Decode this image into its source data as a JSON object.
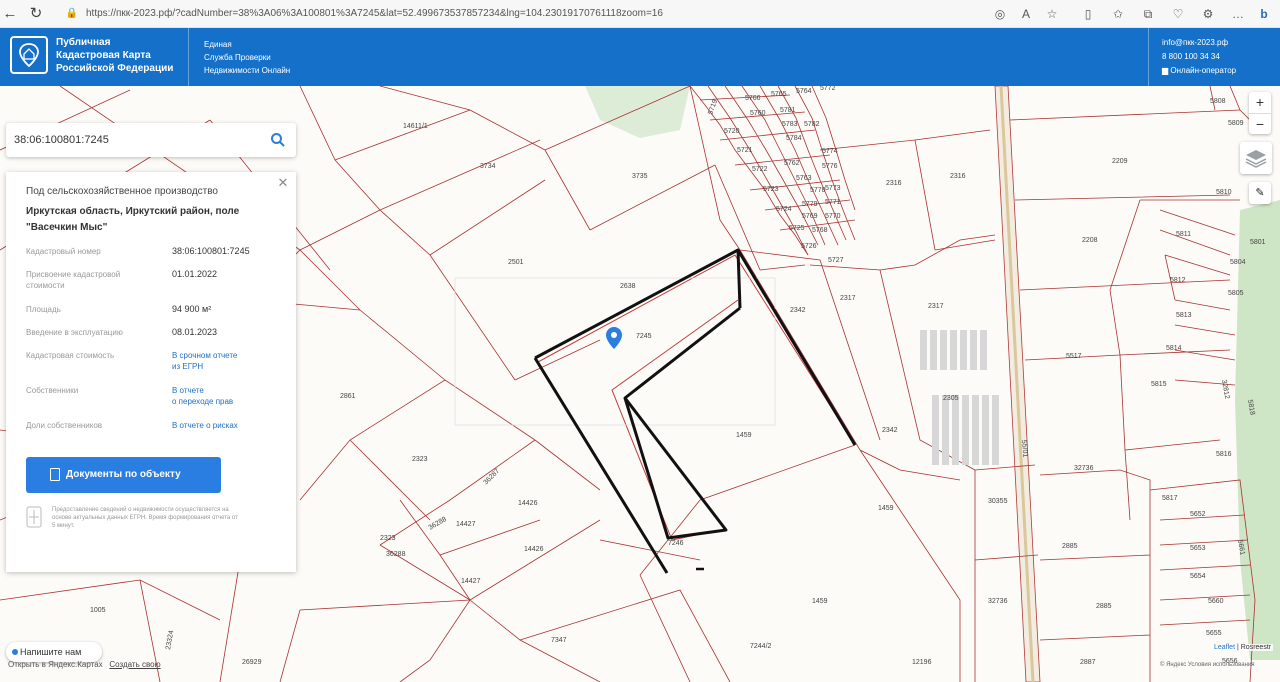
{
  "browser": {
    "url": "https://пкк-2023.рф/?cadNumber=38%3A06%3A100801%3A7245&lat=52.499673537857234&lng=104.23019170761118zoom=16"
  },
  "header": {
    "title_lines": [
      "Публичная",
      "Кадастровая Карта",
      "Российской Федерации"
    ],
    "service_lines": [
      "Единая",
      "Служба Проверки",
      "Недвижимости Онлайн"
    ],
    "email": "info@пкк-2023.рф",
    "phone": "8 800 100 34 34",
    "operator": "Онлайн-оператор",
    "brand_color": "#1470c9"
  },
  "search": {
    "value": "38:06:100801:7245",
    "icon": "search-icon"
  },
  "panel": {
    "category": "Под сельскохозяйственное производство",
    "address_line1": "Иркутская область, Иркутский район, поле",
    "address_line2": "\"Васечкин Мыс\"",
    "rows": [
      {
        "label": "Кадастровый номер",
        "value": "38:06:100801:7245"
      },
      {
        "label": "Присвоение кадастровой стоимости",
        "value": "01.01.2022"
      },
      {
        "label": "Площадь",
        "value": "94 900 м²"
      },
      {
        "label": "Введение в эксплуатацию",
        "value": "08.01.2023"
      }
    ],
    "cadastral_value_label": "Кадастровая стоимость",
    "cadastral_value_link1": "В срочном отчете",
    "cadastral_value_link2": "из ЕГРН",
    "owners_label": "Собственники",
    "owners_link1": "В отчете",
    "owners_link2": "о переходе прав",
    "shares_label": "Доли собственников",
    "shares_link": "В отчете о рисках",
    "documents_button": "Документы по объекту",
    "disclaimer": "Предоставление сведений о недвижимости осуществляется на основе актуальных данных ЕГРН. Время формирования отчета от 5 минут."
  },
  "map": {
    "zoom_in": "+",
    "zoom_out": "−",
    "parcel_labels": [
      "14611/1",
      "3734",
      "3735",
      "2501",
      "2638",
      "7245",
      "2861",
      "1459",
      "2323",
      "36287",
      "14426",
      "36288",
      "14427",
      "2323",
      "36288",
      "14426",
      "14427",
      "7246",
      "7347",
      "1005",
      "23324",
      "26929",
      "7244/2",
      "1459",
      "1459",
      "2342",
      "2317",
      "2342",
      "2317",
      "2305",
      "2316",
      "2316",
      "5766",
      "5765",
      "5764",
      "5772",
      "5719",
      "5720",
      "5721",
      "5722",
      "5723",
      "5724",
      "5725",
      "5726",
      "5727",
      "5760",
      "5781",
      "5782",
      "5783",
      "5784",
      "5762",
      "5763",
      "5774",
      "5776",
      "5778",
      "5779",
      "5770",
      "5771",
      "5773",
      "5768",
      "5769",
      "2209",
      "2208",
      "5808",
      "5809",
      "5810",
      "5811",
      "5801",
      "5804",
      "5805",
      "5812",
      "5813",
      "5814",
      "5815",
      "5816",
      "5817",
      "5652",
      "5653",
      "5654",
      "5655",
      "5656",
      "5660",
      "5661",
      "5517",
      "30355",
      "32736",
      "32736",
      "2885",
      "2885",
      "2887",
      "12196",
      "32812",
      "5818",
      "5819"
    ],
    "road_label": "55/01"
  },
  "chat": {
    "label": "Напишите нам"
  },
  "footer": {
    "left_text": "Открыть в Яндекс.Картах",
    "create_link": "Создать свою",
    "attrib_leaflet": "Leaflet",
    "attrib_sep": " | ",
    "attrib_rosreestr": "Rosreestr",
    "attrib_bottom": "© Яндекс Условия использования"
  }
}
